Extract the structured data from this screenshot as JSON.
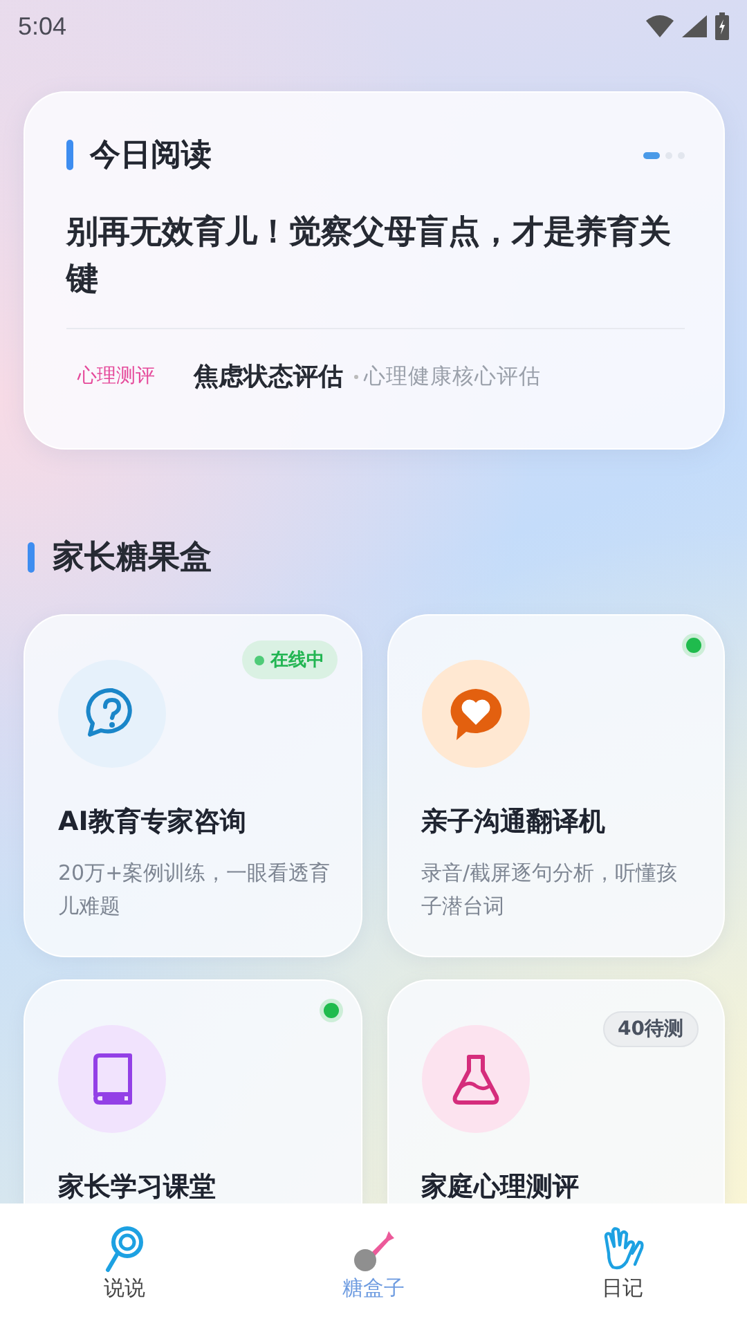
{
  "status_bar": {
    "time": "5:04"
  },
  "today_reading": {
    "title": "今日阅读",
    "pager": [
      {
        "selected": true
      },
      {
        "selected": false
      },
      {
        "selected": false
      }
    ],
    "headline": "别再无效育儿！觉察父母盲点，才是养育关键",
    "tag": "心理测评",
    "item_title": "焦虑状态评估",
    "item_subtitle": "心理健康核心评估"
  },
  "section": {
    "title": "家长糖果盒"
  },
  "cards": [
    {
      "title": "AI教育专家咨询",
      "description": "20万+案例训练，一眼看透育儿难题",
      "badge": {
        "kind": "pill",
        "text": "在线中"
      }
    },
    {
      "title": "亲子沟通翻译机",
      "description": "录音/截屏逐句分析，听懂孩子潜台词",
      "badge": {
        "kind": "dot"
      }
    },
    {
      "title": "家长学习课堂",
      "badge": {
        "kind": "dot"
      }
    },
    {
      "title": "家庭心理测评",
      "badge": {
        "kind": "count",
        "text": "40待测"
      }
    }
  ],
  "bottom_nav": [
    {
      "label": "说说",
      "selected": false
    },
    {
      "label": "糖盒子",
      "selected": true
    },
    {
      "label": "日记",
      "selected": false
    }
  ]
}
